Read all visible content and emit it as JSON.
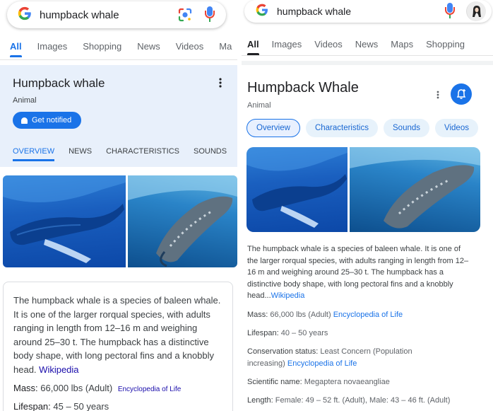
{
  "left": {
    "search": {
      "query": "humpback whale"
    },
    "tabs": [
      "All",
      "Images",
      "Shopping",
      "News",
      "Videos",
      "Ma"
    ],
    "kp": {
      "title": "Humpback whale",
      "subtitle": "Animal",
      "notify_label": "Get notified",
      "tabs": [
        "OVERVIEW",
        "NEWS",
        "CHARACTERISTICS",
        "SOUNDS"
      ]
    },
    "description": "The humpback whale is a species of baleen whale. It is one of the larger rorqual species, with adults ranging in length from 12–16 m and weighing around 25–30 t. The humpback has a distinctive body shape, with long pectoral fins and a knobbly head.",
    "description_source": "Wikipedia",
    "facts": {
      "mass_key": "Mass:",
      "mass_value": "66,000 lbs (Adult)",
      "mass_source": "Encyclopedia of Life",
      "lifespan_key": "Lifespan:",
      "lifespan_value": "45 – 50 years"
    }
  },
  "right": {
    "search": {
      "query": "humpback whale"
    },
    "tabs": [
      "All",
      "Images",
      "Videos",
      "News",
      "Maps",
      "Shopping"
    ],
    "kp": {
      "title": "Humpback Whale",
      "subtitle": "Animal",
      "chips": [
        "Overview",
        "Characteristics",
        "Sounds",
        "Videos"
      ]
    },
    "description": "The humpback whale is a species of baleen whale. It is one of the larger rorqual species, with adults ranging in length from 12–16 m and weighing around 25–30 t. The humpback has a distinctive body shape, with long pectoral fins and a knobbly head...",
    "description_source": "Wikipedia",
    "facts": {
      "mass_key": "Mass:",
      "mass_value": "66,000 lbs (Adult)",
      "mass_source": "Encyclopedia of Life",
      "lifespan_key": "Lifespan:",
      "lifespan_value": "40 – 50 years",
      "conservation_key": "Conservation status:",
      "conservation_value_1": "Least Concern (Population",
      "conservation_value_2": "increasing)",
      "conservation_source": "Encyclopedia of Life",
      "scientific_key": "Scientific name:",
      "scientific_value": "Megaptera novaeangliae",
      "length_key": "Length:",
      "length_value": "Female: 49 – 52 ft. (Adult), Male: 43 – 46 ft. (Adult)"
    }
  },
  "colors": {
    "accent": "#1a73e8",
    "link": "#1a0dab",
    "kp_header_bg": "#e8f0fb",
    "chip_bg": "#e7f2fb"
  },
  "icons": [
    "google-logo",
    "lens-icon",
    "mic-icon",
    "avatar-icon",
    "more-vert-icon",
    "bell-icon",
    "bell-add-icon"
  ]
}
